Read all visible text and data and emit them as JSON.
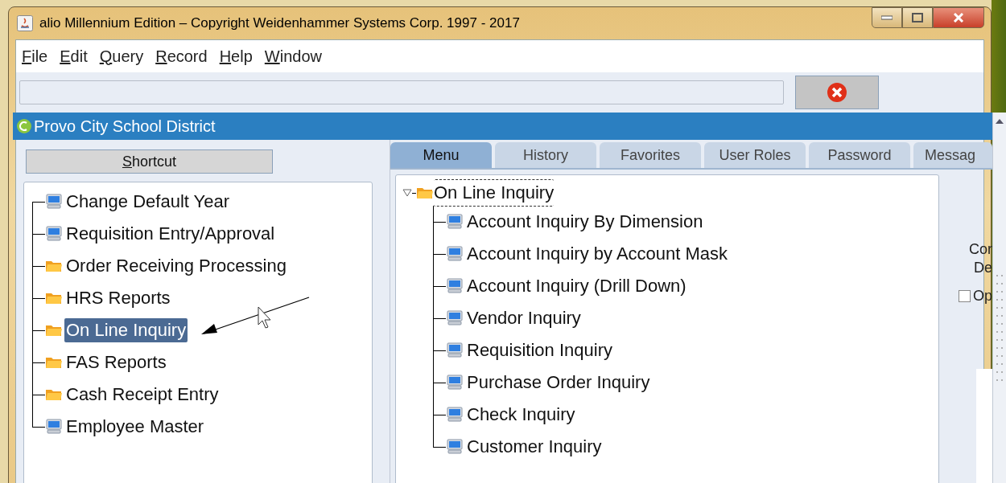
{
  "window": {
    "title": "alio Millennium Edition – Copyright Weidenhammer Systems Corp. 1997 - 2017"
  },
  "menu": [
    {
      "label": "File",
      "mnemonic": true
    },
    {
      "label": "Edit",
      "mnemonic": true
    },
    {
      "label": "Query",
      "mnemonic": true
    },
    {
      "label": "Record",
      "mnemonic": true
    },
    {
      "label": "Help",
      "mnemonic": true
    },
    {
      "label": "Window",
      "mnemonic": true
    }
  ],
  "frame": {
    "title": "Provo City School District"
  },
  "shortcut_button": {
    "label": "Shortcut",
    "mnemonic": true
  },
  "shortcuts": [
    {
      "label": "Change Default Year",
      "kind": "program",
      "selected": false
    },
    {
      "label": "Requisition Entry/Approval",
      "kind": "program",
      "selected": false
    },
    {
      "label": "Order Receiving Processing",
      "kind": "folder",
      "selected": false
    },
    {
      "label": "HRS Reports",
      "kind": "folder",
      "selected": false
    },
    {
      "label": "On Line Inquiry",
      "kind": "folder",
      "selected": true
    },
    {
      "label": "FAS Reports",
      "kind": "folder",
      "selected": false
    },
    {
      "label": "Cash Receipt Entry",
      "kind": "folder",
      "selected": false
    },
    {
      "label": "Employee Master",
      "kind": "program",
      "selected": false
    }
  ],
  "tabs": [
    {
      "label": "Menu",
      "selected": true
    },
    {
      "label": "History",
      "selected": false
    },
    {
      "label": "Favorites",
      "selected": false
    },
    {
      "label": "User Roles",
      "selected": false
    },
    {
      "label": "Password",
      "selected": false
    },
    {
      "label": "Messag",
      "selected": false
    }
  ],
  "menu_tree": {
    "label": "On Line Inquiry",
    "kind": "folder",
    "expanded": true,
    "children": [
      {
        "label": "Account Inquiry By Dimension",
        "kind": "program"
      },
      {
        "label": "Account Inquiry by Account Mask",
        "kind": "program"
      },
      {
        "label": "Account Inquiry (Drill Down)",
        "kind": "program"
      },
      {
        "label": "Vendor Inquiry",
        "kind": "program"
      },
      {
        "label": "Requisition Inquiry",
        "kind": "program"
      },
      {
        "label": "Purchase Order Inquiry",
        "kind": "program"
      },
      {
        "label": "Check Inquiry",
        "kind": "program"
      },
      {
        "label": "Customer Inquiry",
        "kind": "program"
      }
    ]
  },
  "side_texts": [
    "Cor",
    "De"
  ],
  "side_checkbox": {
    "label": "Op",
    "checked": false
  }
}
